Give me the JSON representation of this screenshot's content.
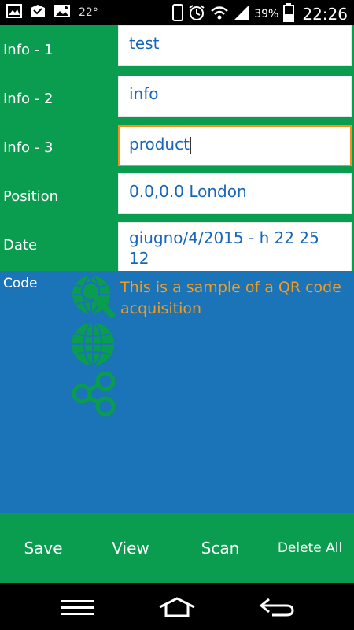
{
  "status_bar": {
    "temperature": "22°",
    "battery": "39%",
    "time": "22:26",
    "icons": [
      "gallery-icon",
      "mail-icon",
      "image-icon",
      "phone-icon",
      "alarm-icon",
      "wifi-icon",
      "signal-icon",
      "battery-icon"
    ]
  },
  "form": {
    "rows": [
      {
        "label": "Info - 1",
        "value": "test"
      },
      {
        "label": "Info - 2",
        "value": "info"
      },
      {
        "label": "Info - 3",
        "value": "product"
      },
      {
        "label": "Position",
        "value": "0.0,0.0 London"
      },
      {
        "label": "Date",
        "value": "giugno/4/2015 - h 22 25 12"
      }
    ],
    "focused_row": 2
  },
  "code": {
    "label": "Code",
    "description": "This is a sample of a QR code acquisition",
    "icons": [
      "search-globe-icon",
      "globe-icon",
      "share-icon"
    ]
  },
  "buttons": {
    "save": "Save",
    "view": "View",
    "scan": "Scan",
    "delete_all": "Delete All"
  },
  "navigation": {
    "icons": [
      "menu-icon",
      "home-icon",
      "back-icon"
    ]
  },
  "colors": {
    "green": "#0a9c4f",
    "blue": "#1b73b8",
    "field_text": "#1867b9",
    "accent_orange": "#f39c1e",
    "focus_border": "#f7911d"
  }
}
